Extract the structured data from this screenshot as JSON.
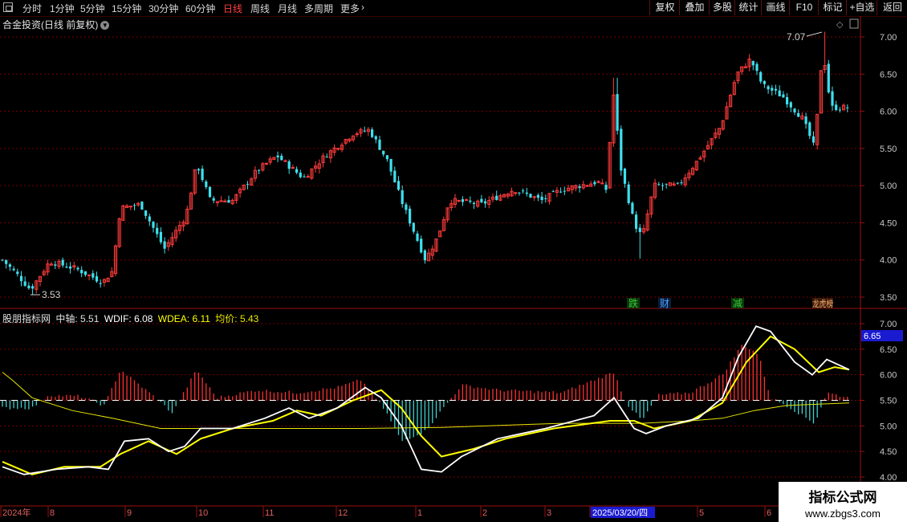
{
  "toolbar": {
    "periods": [
      "分时",
      "1分钟",
      "5分钟",
      "15分钟",
      "30分钟",
      "60分钟",
      "日线",
      "周线",
      "月线",
      "多周期",
      "更多"
    ],
    "active_period": "日线",
    "more_arrow": "›",
    "right_buttons": [
      "复权",
      "叠加",
      "多股",
      "统计",
      "画线",
      "F10",
      "标记",
      "+自选",
      "返回"
    ]
  },
  "main_chart": {
    "title": "合金投资(日线 前复权)",
    "price_labels": [
      "7.00",
      "6.50",
      "6.00",
      "5.50",
      "5.00",
      "4.50",
      "4.00",
      "3.50"
    ],
    "high_marker": "7.07",
    "low_marker": "3.53",
    "event_tags": [
      {
        "text": "跌",
        "color": "#3cc83c",
        "bg": "#0a3a0a"
      },
      {
        "text": "财",
        "color": "#4aa0ff",
        "bg": "#0a1e3a"
      },
      {
        "text": "减",
        "color": "#3cc83c",
        "bg": "#0a3a0a"
      },
      {
        "text": "龙虎榜",
        "color": "#ffb070",
        "bg": "#3a1a0a"
      }
    ]
  },
  "indicator": {
    "name": "股朋指标网",
    "mid_label": "中轴:",
    "mid_value": "5.51",
    "wdif_label": "WDIF:",
    "wdif_value": "6.08",
    "wdea_label": "WDEA:",
    "wdea_value": "6.11",
    "avg_label": "均价:",
    "avg_value": "5.43",
    "axis_labels": [
      "7.00",
      "6.50",
      "6.00",
      "5.50",
      "5.00",
      "4.50",
      "4.00"
    ],
    "current_value": "6.65",
    "colors": {
      "wdif": "#ffffff",
      "wdea": "#ffff00",
      "avg": "#e6e600",
      "bar_up": "#ff3030",
      "bar_down": "#40d0d0"
    }
  },
  "time_axis": {
    "labels": [
      "2024年",
      "8",
      "9",
      "10",
      "11",
      "12",
      "1",
      "2",
      "3",
      "2025/03/20/四",
      "5",
      "6"
    ],
    "highlight": "2025/03/20/四"
  },
  "watermark": {
    "line1": "指标公式网",
    "line2": "www.zbgs3.com"
  },
  "colors": {
    "up": "#ff3b3b",
    "down": "#3ee0ee",
    "grid": "#7a0000",
    "frame": "#9a1010",
    "text": "#c8c8c8"
  }
}
